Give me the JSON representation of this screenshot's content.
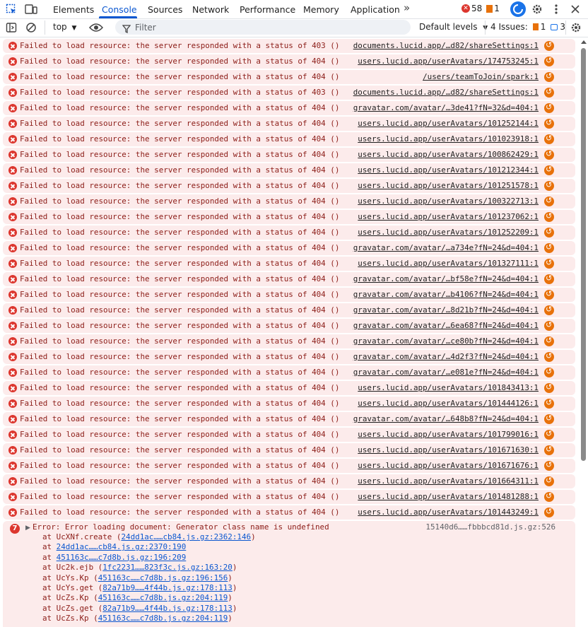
{
  "tabs": [
    "Elements",
    "Console",
    "Sources",
    "Network",
    "Performance",
    "Memory",
    "Application"
  ],
  "more_tabs": "»",
  "counts": {
    "errors": "58",
    "warnings": "1"
  },
  "toolbar": {
    "context": "top",
    "filter_placeholder": "Filter",
    "levels": "Default levels",
    "issues_label": "4 Issues:",
    "issues_warn": "1",
    "issues_info": "3"
  },
  "colors": {
    "accent": "#0b57d0",
    "error": "#dc362e",
    "error_bg": "#fcebeb",
    "error_text": "#8c1d18"
  },
  "icons": [
    "inspect-icon",
    "device-toolbar-icon",
    "sidebar-icon",
    "clear-icon",
    "eye-icon",
    "filter-icon",
    "settings-icon",
    "kebab-icon",
    "close-icon",
    "chevron-down-icon",
    "error-icon",
    "network-request-icon"
  ],
  "messages": [
    {
      "text": "Failed to load resource: the server responded with a status of 403 ()",
      "src": "documents.lucid.app/…d82/shareSettings:1"
    },
    {
      "text": "Failed to load resource: the server responded with a status of 404 ()",
      "src": "users.lucid.app/userAvatars/174753245:1"
    },
    {
      "text": "Failed to load resource: the server responded with a status of 404 ()",
      "src": "/users/teamToJoin/spark:1"
    },
    {
      "text": "Failed to load resource: the server responded with a status of 403 ()",
      "src": "documents.lucid.app/…d82/shareSettings:1"
    },
    {
      "text": "Failed to load resource: the server responded with a status of 404 ()",
      "src": "gravatar.com/avatar/…3de41?fN=32&d=404:1"
    },
    {
      "text": "Failed to load resource: the server responded with a status of 404 ()",
      "src": "users.lucid.app/userAvatars/101252144:1"
    },
    {
      "text": "Failed to load resource: the server responded with a status of 404 ()",
      "src": "users.lucid.app/userAvatars/101023918:1"
    },
    {
      "text": "Failed to load resource: the server responded with a status of 404 ()",
      "src": "users.lucid.app/userAvatars/100862429:1"
    },
    {
      "text": "Failed to load resource: the server responded with a status of 404 ()",
      "src": "users.lucid.app/userAvatars/101212344:1"
    },
    {
      "text": "Failed to load resource: the server responded with a status of 404 ()",
      "src": "users.lucid.app/userAvatars/101251578:1"
    },
    {
      "text": "Failed to load resource: the server responded with a status of 404 ()",
      "src": "users.lucid.app/userAvatars/100322713:1"
    },
    {
      "text": "Failed to load resource: the server responded with a status of 404 ()",
      "src": "users.lucid.app/userAvatars/101237062:1"
    },
    {
      "text": "Failed to load resource: the server responded with a status of 404 ()",
      "src": "users.lucid.app/userAvatars/101252209:1"
    },
    {
      "text": "Failed to load resource: the server responded with a status of 404 ()",
      "src": "gravatar.com/avatar/…a734e?fN=24&d=404:1"
    },
    {
      "text": "Failed to load resource: the server responded with a status of 404 ()",
      "src": "users.lucid.app/userAvatars/101327111:1"
    },
    {
      "text": "Failed to load resource: the server responded with a status of 404 ()",
      "src": "gravatar.com/avatar/…bf58e?fN=24&d=404:1"
    },
    {
      "text": "Failed to load resource: the server responded with a status of 404 ()",
      "src": "gravatar.com/avatar/…b4106?fN=24&d=404:1"
    },
    {
      "text": "Failed to load resource: the server responded with a status of 404 ()",
      "src": "gravatar.com/avatar/…8d21b?fN=24&d=404:1"
    },
    {
      "text": "Failed to load resource: the server responded with a status of 404 ()",
      "src": "gravatar.com/avatar/…6ea68?fN=24&d=404:1"
    },
    {
      "text": "Failed to load resource: the server responded with a status of 404 ()",
      "src": "gravatar.com/avatar/…ce80b?fN=24&d=404:1"
    },
    {
      "text": "Failed to load resource: the server responded with a status of 404 ()",
      "src": "gravatar.com/avatar/…4d2f3?fN=24&d=404:1"
    },
    {
      "text": "Failed to load resource: the server responded with a status of 404 ()",
      "src": "gravatar.com/avatar/…e081e?fN=24&d=404:1"
    },
    {
      "text": "Failed to load resource: the server responded with a status of 404 ()",
      "src": "users.lucid.app/userAvatars/101843413:1"
    },
    {
      "text": "Failed to load resource: the server responded with a status of 404 ()",
      "src": "users.lucid.app/userAvatars/101444126:1"
    },
    {
      "text": "Failed to load resource: the server responded with a status of 404 ()",
      "src": "gravatar.com/avatar/…648b8?fN=24&d=404:1"
    },
    {
      "text": "Failed to load resource: the server responded with a status of 404 ()",
      "src": "users.lucid.app/userAvatars/101799016:1"
    },
    {
      "text": "Failed to load resource: the server responded with a status of 404 ()",
      "src": "users.lucid.app/userAvatars/101671630:1"
    },
    {
      "text": "Failed to load resource: the server responded with a status of 404 ()",
      "src": "users.lucid.app/userAvatars/101671676:1"
    },
    {
      "text": "Failed to load resource: the server responded with a status of 404 ()",
      "src": "users.lucid.app/userAvatars/101664311:1"
    },
    {
      "text": "Failed to load resource: the server responded with a status of 404 ()",
      "src": "users.lucid.app/userAvatars/101481288:1"
    },
    {
      "text": "Failed to load resource: the server responded with a status of 404 ()",
      "src": "users.lucid.app/userAvatars/101443249:1"
    }
  ],
  "stack_error": {
    "count": "7",
    "text": "Error: Error loading document: Generator class name is undefined",
    "src": "15140d6……fbbbcd81d.js.gz:526",
    "frames": [
      {
        "prefix": "at UcXNf.create (",
        "link": "24dd1ac……cb84.js.gz:2362:146",
        "suffix": ")"
      },
      {
        "prefix": "at ",
        "link": "24dd1ac……cb84.js.gz:2370:190",
        "suffix": ""
      },
      {
        "prefix": "at ",
        "link": "451163c……c7d8b.js.gz:196:209",
        "suffix": ""
      },
      {
        "prefix": "at Uc2k.ejb (",
        "link": "1fc2231……823f3c.js.gz:163:20",
        "suffix": ")"
      },
      {
        "prefix": "at UcYs.Kp (",
        "link": "451163c……c7d8b.js.gz:196:156",
        "suffix": ")"
      },
      {
        "prefix": "at UcYs.get (",
        "link": "82a71b9……4f44b.js.gz:178:113",
        "suffix": ")"
      },
      {
        "prefix": "at UcZs.Kp (",
        "link": "451163c……c7d8b.js.gz:204:119",
        "suffix": ")"
      },
      {
        "prefix": "at UcZs.get (",
        "link": "82a71b9……4f44b.js.gz:178:113",
        "suffix": ")"
      },
      {
        "prefix": "at UcZs.Kp (",
        "link": "451163c……c7d8b.js.gz:204:119",
        "suffix": ")"
      }
    ]
  }
}
